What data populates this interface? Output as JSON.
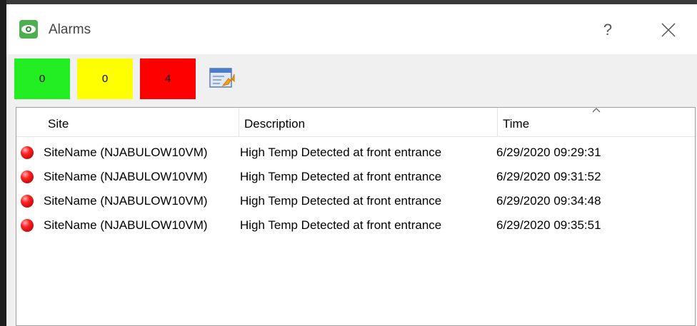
{
  "window": {
    "title": "Alarms",
    "help_label": "?"
  },
  "toolbar": {
    "counters": [
      {
        "label": "0",
        "color": "#22ee22"
      },
      {
        "label": "0",
        "color": "#ffff00"
      },
      {
        "label": "4",
        "color": "#ff0000"
      }
    ],
    "export_icon": "export-report-icon"
  },
  "table": {
    "columns": [
      "Site",
      "Description",
      "Time"
    ],
    "sort_column": "Time",
    "sort_direction": "ascending",
    "rows": [
      {
        "site": "SiteName (NJABULOW10VM)",
        "description": "High Temp Detected at front entrance",
        "time": "6/29/2020 09:29:31"
      },
      {
        "site": "SiteName (NJABULOW10VM)",
        "description": "High Temp Detected at front entrance",
        "time": "6/29/2020 09:31:52"
      },
      {
        "site": "SiteName (NJABULOW10VM)",
        "description": "High Temp Detected at front entrance",
        "time": "6/29/2020 09:34:48"
      },
      {
        "site": "SiteName (NJABULOW10VM)",
        "description": "High Temp Detected at front entrance",
        "time": "6/29/2020 09:35:51"
      }
    ]
  }
}
